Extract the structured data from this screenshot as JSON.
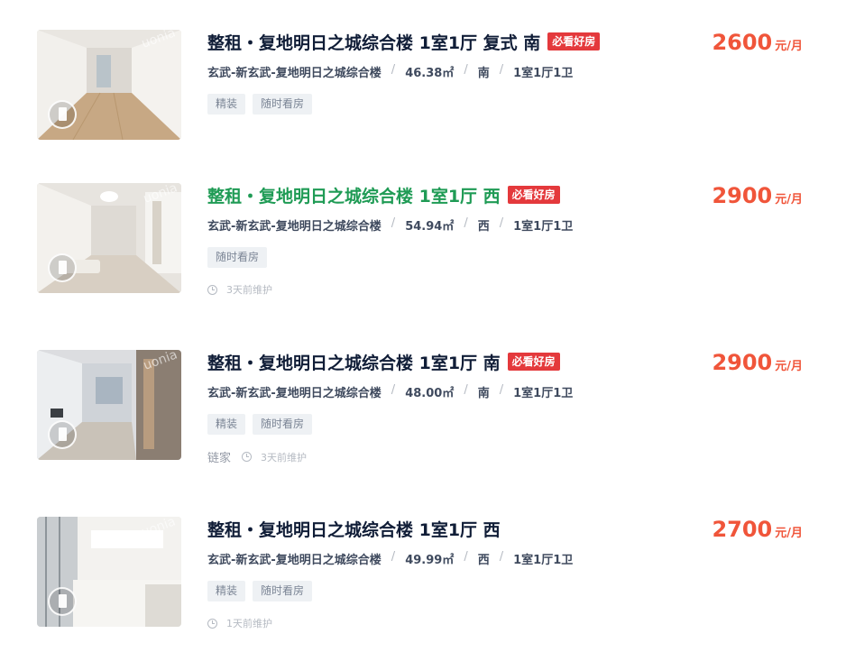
{
  "listings": [
    {
      "title": "整租・复地明日之城综合楼 1室1厅 复式 南",
      "badge": "必看好房",
      "district": "玄武-新玄武-复地明日之城综合楼",
      "area": "46.38㎡",
      "orientation": "南",
      "layout": "1室1厅1卫",
      "tags": [
        "精装",
        "随时看房"
      ],
      "price": "2600",
      "price_unit": "元/月"
    },
    {
      "title": "整租・复地明日之城综合楼 1室1厅 西",
      "badge": "必看好房",
      "district": "玄武-新玄武-复地明日之城综合楼",
      "area": "54.94㎡",
      "orientation": "西",
      "layout": "1室1厅1卫",
      "tags": [
        "随时看房"
      ],
      "maintained": "3天前维护",
      "price": "2900",
      "price_unit": "元/月"
    },
    {
      "title": "整租・复地明日之城综合楼 1室1厅 南",
      "badge": "必看好房",
      "district": "玄武-新玄武-复地明日之城综合楼",
      "area": "48.00㎡",
      "orientation": "南",
      "layout": "1室1厅1卫",
      "tags": [
        "精装",
        "随时看房"
      ],
      "brand": "链家",
      "maintained": "3天前维护",
      "price": "2900",
      "price_unit": "元/月"
    },
    {
      "title": "整租・复地明日之城综合楼 1室1厅 西",
      "district": "玄武-新玄武-复地明日之城综合楼",
      "area": "49.99㎡",
      "orientation": "西",
      "layout": "1室1厅1卫",
      "tags": [
        "精装",
        "随时看房"
      ],
      "maintained": "1天前维护",
      "price": "2700",
      "price_unit": "元/月"
    }
  ],
  "colors": {
    "price": "#f0553a",
    "badge": "#e4393c",
    "visited_title": "#1f9b55",
    "title": "#101d37"
  },
  "thumbnail_watermark": "uonia"
}
